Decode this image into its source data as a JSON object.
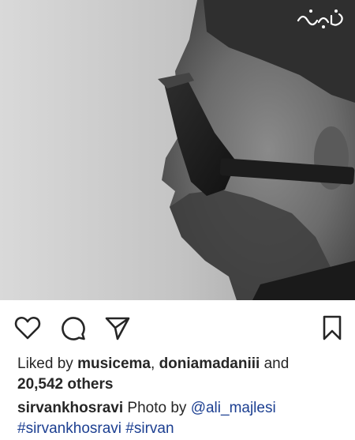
{
  "post": {
    "image": {
      "description_icon": "photo",
      "watermark_text": "برترین‌ها"
    },
    "actions": {
      "like_icon": "heart-icon",
      "comment_icon": "comment-icon",
      "share_icon": "send-icon",
      "save_icon": "bookmark-icon"
    },
    "likes": {
      "prefix": "Liked by",
      "user1": "musicema",
      "separator": ",",
      "user2": "doniamadaniii",
      "and": "and",
      "count": "20,542 others"
    },
    "caption": {
      "username": "sirvankhosravi",
      "text": "Photo by",
      "mention": "@ali_majlesi",
      "hashtag1": "#sirvankhosravi",
      "hashtag2": "#sirvan"
    }
  },
  "colors": {
    "text": "#262626",
    "link": "#1c3f91"
  }
}
